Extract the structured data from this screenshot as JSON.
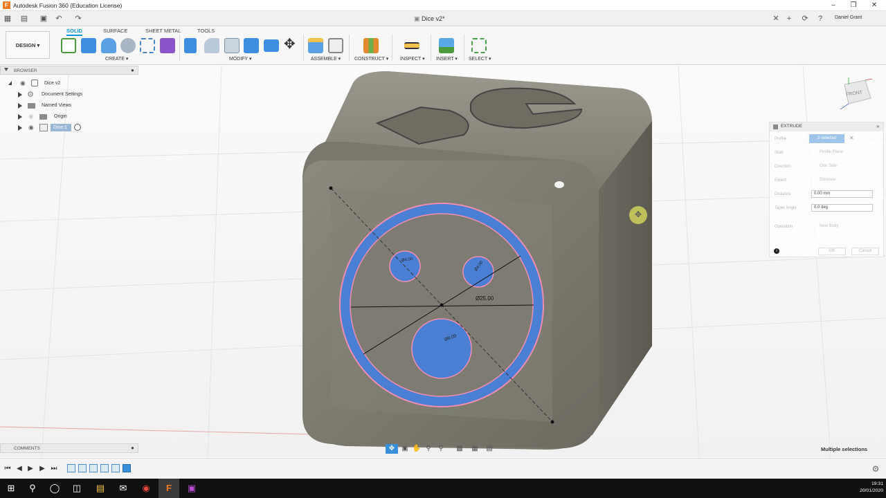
{
  "window": {
    "title": "Autodesk Fusion 360 (Education License)",
    "doc_tab": "Dice v2*",
    "user": "Daniel Grant"
  },
  "workspace": {
    "mode": "DESIGN ▾"
  },
  "tabs": [
    "SOLID",
    "SURFACE",
    "SHEET METAL",
    "TOOLS"
  ],
  "groups": {
    "create": "CREATE ▾",
    "modify": "MODIFY ▾",
    "assemble": "ASSEMBLE ▾",
    "construct": "CONSTRUCT ▾",
    "inspect": "INSPECT ▾",
    "insert": "INSERT ▾",
    "select": "SELECT ▾"
  },
  "browser": {
    "title": "BROWSER",
    "items": [
      "Dice v2",
      "Document Settings",
      "Named Views",
      "Origin",
      "Dice:1"
    ]
  },
  "viewcube": {
    "label": "FRONT"
  },
  "dimensions": {
    "outer": "Ø25.00",
    "small": "Ø4.00",
    "small2": "Ø4.00",
    "large": "Ø8.00"
  },
  "extrude": {
    "title": "EXTRUDE",
    "profile_label": "Profile",
    "profile_value": "2 selected",
    "start_label": "Start",
    "start_value": "Profile Plane",
    "direction_label": "Direction",
    "direction_value": "One Side",
    "extent_label": "Extent",
    "extent_value": "Distance",
    "distance_label": "Distance",
    "distance_value": "0.00 mm",
    "taper_label": "Taper Angle",
    "taper_value": "0.0 deg",
    "operation_label": "Operation",
    "operation_value": "New Body",
    "ok": "OK",
    "cancel": "Cancel"
  },
  "comments": {
    "title": "COMMENTS"
  },
  "status": {
    "selection": "Multiple selections"
  },
  "clock": {
    "time": "19:31",
    "date": "20/01/2020"
  }
}
